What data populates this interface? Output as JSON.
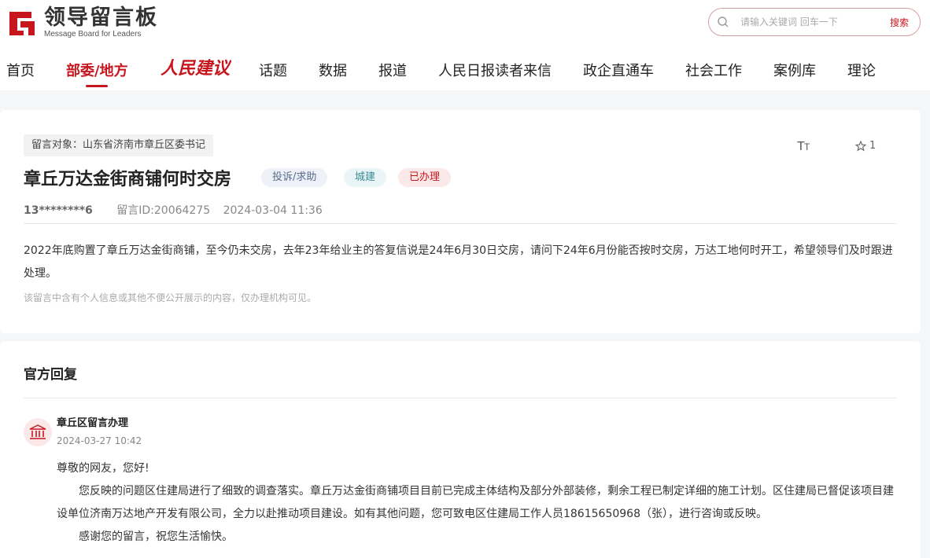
{
  "header": {
    "logo_title": "领导留言板",
    "logo_sub": "Message Board for Leaders",
    "search_placeholder": "请输入关键词 回车一下",
    "search_button": "搜索"
  },
  "nav": {
    "items": [
      "首页",
      "部委/地方",
      "人民建议",
      "话题",
      "数据",
      "报道",
      "人民日报读者来信",
      "政企直通车",
      "社会工作",
      "案例库",
      "理论"
    ]
  },
  "message": {
    "target": "留言对象：山东省济南市章丘区委书记",
    "font_toggle": "TT",
    "fav_count": "1",
    "title": "章丘万达金街商铺何时交房",
    "tags": [
      "投诉/求助",
      "城建",
      "已办理"
    ],
    "user": "13********6",
    "message_id": "留言ID:20064275",
    "date": "2024-03-04 11:36",
    "content": "2022年底购置了章丘万达金街商铺，至今仍未交房，去年23年给业主的答复信说是24年6月30日交房，请问下24年6月份能否按时交房，万达工地何时开工，希望领导们及时跟进处理。",
    "note": "该留言中含有个人信息或其他不便公开展示的内容，仅办理机构可见。"
  },
  "reply": {
    "section_title": "官方回复",
    "replier_name": "章丘区留言办理",
    "reply_time": "2024-03-27 10:42",
    "greeting": "尊敬的网友，您好!",
    "body": "您反映的问题区住建局进行了细致的调查落实。章丘万达金街商铺项目目前已完成主体结构及部分外部装修，剩余工程已制定详细的施工计划。区住建局已督促该项目建设单位济南万达地产开发有限公司，全力以赴推动项目建设。如有其他问题，您可致电区住建局工作人员18615650968（张），进行咨询或反映。",
    "closing": "感谢您的留言，祝您生活愉快。"
  },
  "colors": {
    "brand_red": "#c8161e",
    "page_bg": "#f5f6f8"
  }
}
